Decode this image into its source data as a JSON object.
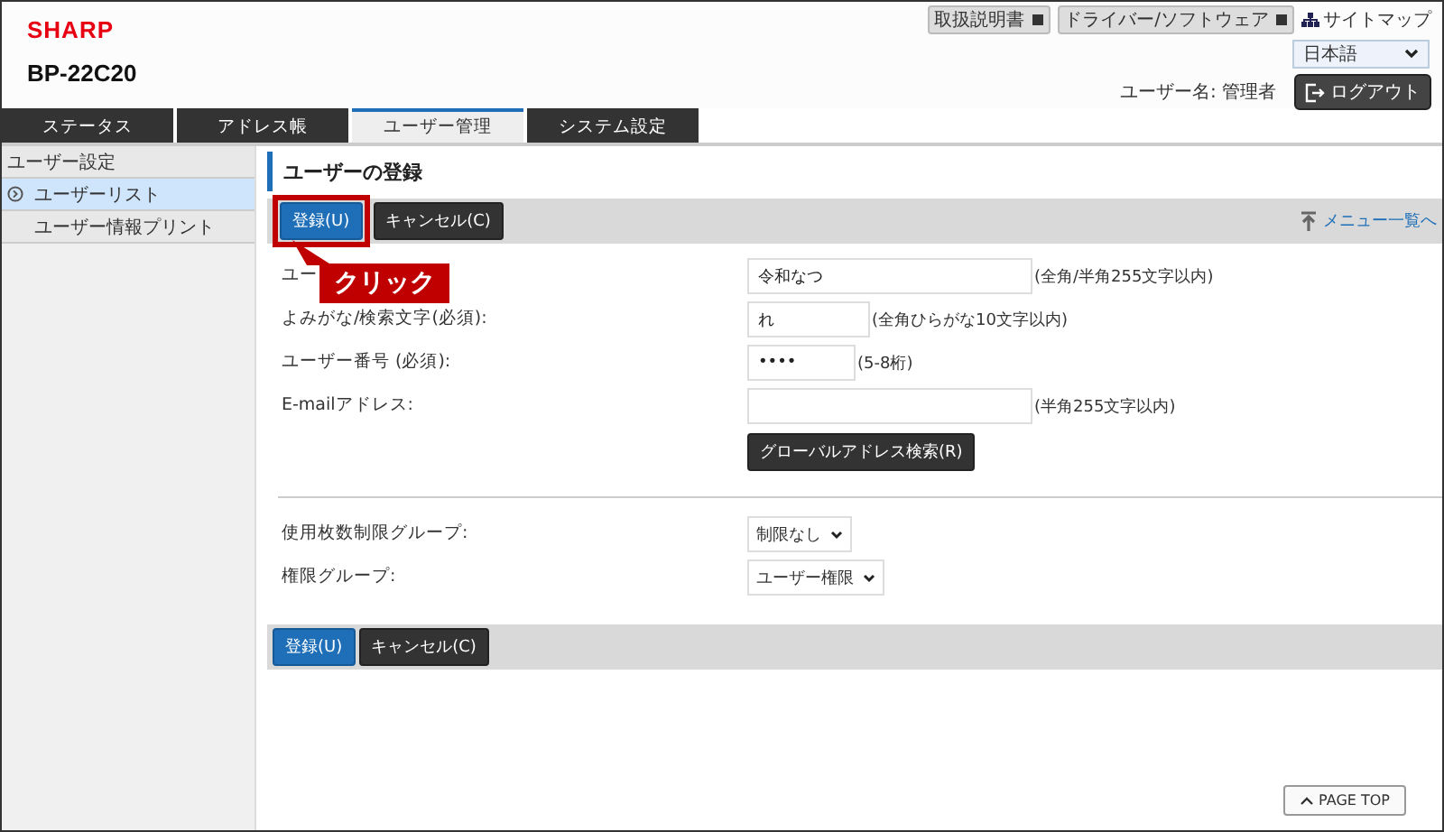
{
  "header": {
    "logo": "SHARP",
    "model": "BP-22C20",
    "links": [
      {
        "label": "取扱説明書",
        "kind": "external"
      },
      {
        "label": "ドライバー/ソフトウェア",
        "kind": "external"
      },
      {
        "label": "サイトマップ",
        "kind": "sitemap"
      }
    ],
    "language": "日本語",
    "user_label": "ユーザー名: 管理者",
    "logout": "ログアウト"
  },
  "tabs": [
    {
      "label": "ステータス",
      "selected": false
    },
    {
      "label": "アドレス帳",
      "selected": false
    },
    {
      "label": "ユーザー管理",
      "selected": true
    },
    {
      "label": "システム設定",
      "selected": false
    }
  ],
  "sidebar": {
    "heading": "ユーザー設定",
    "items": [
      {
        "label": "ユーザーリスト",
        "selected": true
      },
      {
        "label": "ユーザー情報プリント",
        "selected": false
      }
    ]
  },
  "page_title": "ユーザーの登録",
  "actions": {
    "register": "登録(U)",
    "cancel": "キャンセル(C)",
    "menu_link": "メニュー一覧へ"
  },
  "callout": {
    "text": "クリック"
  },
  "fields": [
    {
      "kind": "text",
      "label": "ユー",
      "value": "令和なつ",
      "hint": "(全角/半角255文字以内)"
    },
    {
      "kind": "text",
      "label": "よみがな/検索文字(必須):",
      "value": "れ",
      "hint": "(全角ひらがな10文字以内)"
    },
    {
      "kind": "text",
      "label": "ユーザー番号 (必須):",
      "value": "••••",
      "hint": "(5-8桁)"
    },
    {
      "kind": "text",
      "label": "E-mailアドレス:",
      "hint": "(半角255文字以内)",
      "button": "グローバルアドレス検索(R)"
    }
  ],
  "groups": [
    {
      "kind": "select",
      "label": "使用枚数制限グループ:",
      "value": "制限なし"
    },
    {
      "kind": "select",
      "label": "権限グループ:",
      "value": "ユーザー権限"
    }
  ],
  "bottom_actions": {
    "register": "登録(U)",
    "cancel": "キャンセル(C)"
  },
  "page_top": "PAGE TOP"
}
